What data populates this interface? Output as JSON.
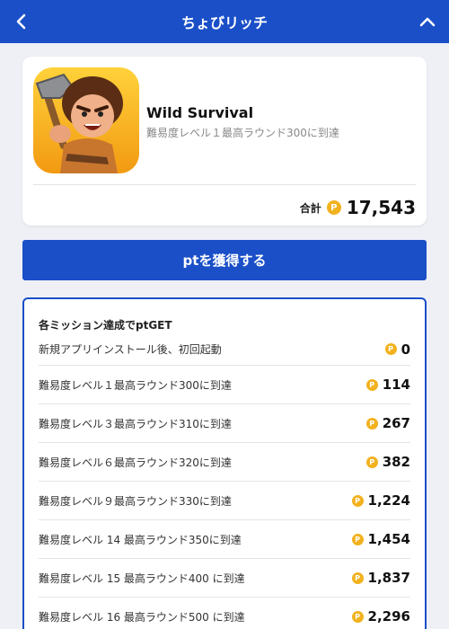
{
  "header": {
    "title": "ちょびリッチ",
    "back_icon": "chevron-left-icon",
    "collapse_icon": "chevron-up-icon"
  },
  "app": {
    "name": "Wild Survival",
    "subtitle": "難易度レベル１最高ラウンド300に到達",
    "icon": "caveman-game-icon",
    "total_label": "合計",
    "total_points": "17,543",
    "coin_symbol": "P"
  },
  "cta": {
    "label": "ptを獲得する"
  },
  "missions": {
    "title": "各ミッション達成でptGET",
    "items": [
      {
        "label": "新規アプリインストール後、初回起動",
        "points": "0"
      },
      {
        "label": "難易度レベル１最高ラウンド300に到達",
        "points": "114"
      },
      {
        "label": "難易度レベル３最高ラウンド310に到達",
        "points": "267"
      },
      {
        "label": "難易度レベル６最高ラウンド320に到達",
        "points": "382"
      },
      {
        "label": "難易度レベル９最高ラウンド330に到達",
        "points": "1,224"
      },
      {
        "label": "難易度レベル 14 最高ラウンド350に到達",
        "points": "1,454"
      },
      {
        "label": "難易度レベル 15 最高ラウンド400 に到達",
        "points": "1,837"
      },
      {
        "label": "難易度レベル 16 最高ラウンド500 に到達",
        "points": "2,296"
      }
    ]
  },
  "colors": {
    "brand_blue": "#1a4fc8",
    "coin_gold": "#f2b21e"
  }
}
